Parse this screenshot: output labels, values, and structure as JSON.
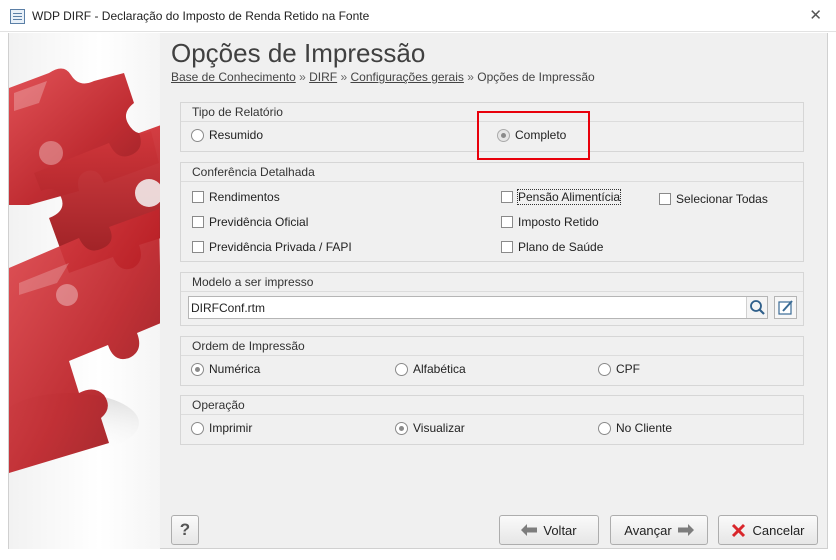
{
  "window": {
    "title": "WDP DIRF - Declaração do Imposto de Renda Retido na Fonte"
  },
  "page": {
    "title": "Opções de Impressão"
  },
  "breadcrumb": {
    "items": [
      "Base de Conhecimento",
      "DIRF",
      "Configurações gerais"
    ],
    "current": "Opções de Impressão",
    "separator": "»"
  },
  "tipo_relatorio": {
    "title": "Tipo de Relatório",
    "options": [
      "Resumido",
      "Completo"
    ],
    "selected": "Completo"
  },
  "conferencia": {
    "title": "Conferência Detalhada",
    "items": [
      "Rendimentos",
      "Previdência Oficial",
      "Previdência Privada / FAPI",
      "Pensão Alimentícia",
      "Imposto Retido",
      "Plano de Saúde"
    ],
    "select_all": "Selecionar Todas"
  },
  "modelo": {
    "title": "Modelo a ser impresso",
    "value": "DIRFConf.rtm"
  },
  "ordem": {
    "title": "Ordem de Impressão",
    "options": [
      "Numérica",
      "Alfabética",
      "CPF"
    ],
    "selected": "Numérica"
  },
  "operacao": {
    "title": "Operação",
    "options": [
      "Imprimir",
      "Visualizar",
      "No Cliente"
    ],
    "selected": "Visualizar"
  },
  "buttons": {
    "help": "?",
    "back": "Voltar",
    "next": "Avançar",
    "cancel": "Cancelar"
  },
  "colors": {
    "highlight": "#e8000b",
    "puzzle_red": "#c0262b",
    "background": "#f0f0f0"
  }
}
